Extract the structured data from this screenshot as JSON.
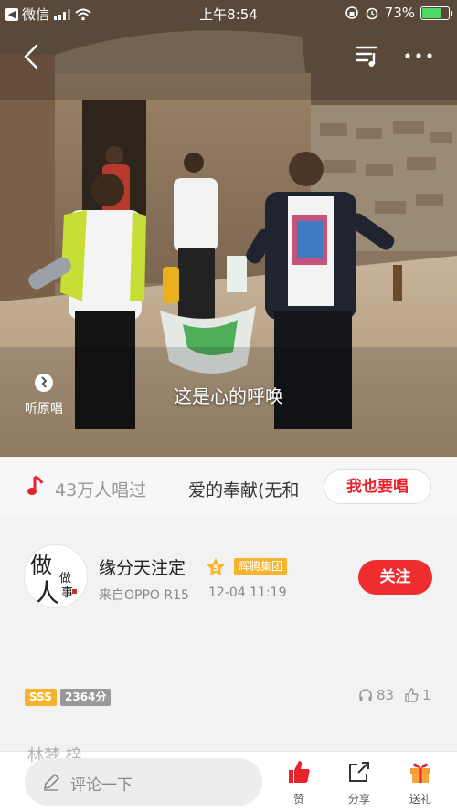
{
  "status_bar": {
    "back_app": "微信",
    "time": "上午8:54",
    "battery": "73%",
    "battery_level": 0.73
  },
  "player": {
    "listen_original": "听原唱",
    "lyric": "这是心的呼唤"
  },
  "song": {
    "sing_count": "43万人唱过",
    "title": "爱的奉献(无和",
    "sing_button": "我也要唱"
  },
  "user": {
    "name": "缘分天注定",
    "group_badge": "辉腾集团",
    "vip_level": "5",
    "device": "来自OPPO R15",
    "time": "12-04 11:19",
    "follow_button": "关注",
    "avatar_text_1": "做",
    "avatar_text_2": "人",
    "avatar_text_3": "做",
    "avatar_text_4": "事"
  },
  "stats": {
    "score_grade": "SSS",
    "points": "2364分",
    "listens": "83",
    "likes": "1"
  },
  "bottom": {
    "peek_text": "林梦 梓",
    "comment_placeholder": "评论一下",
    "like_label": "赞",
    "share_label": "分享",
    "gift_label": "送礼"
  },
  "colors": {
    "accent_red": "#ee2e2e",
    "badge_gold": "#f7b32b",
    "battery_green": "#4cd964"
  }
}
